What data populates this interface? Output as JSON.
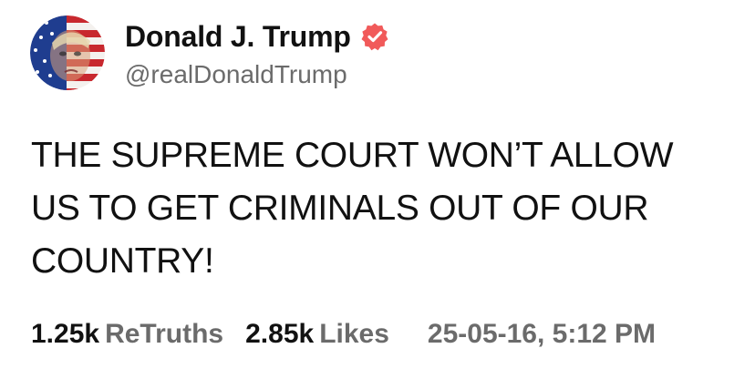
{
  "author": {
    "display_name": "Donald J. Trump",
    "handle": "@realDonaldTrump",
    "verified": true,
    "verified_badge_color": "#f15a5a",
    "avatar_icon": "flag-portrait-avatar"
  },
  "post": {
    "text": "THE SUPREME COURT WON’T ALLOW US TO GET CRIMINALS OUT OF OUR COUNTRY!"
  },
  "stats": {
    "retruths_count": "1.25k",
    "retruths_label": "ReTruths",
    "likes_count": "2.85k",
    "likes_label": "Likes",
    "timestamp": "25-05-16, 5:12 PM"
  },
  "colors": {
    "text_primary": "#111111",
    "text_secondary": "#6b6b6b",
    "background": "#ffffff"
  }
}
